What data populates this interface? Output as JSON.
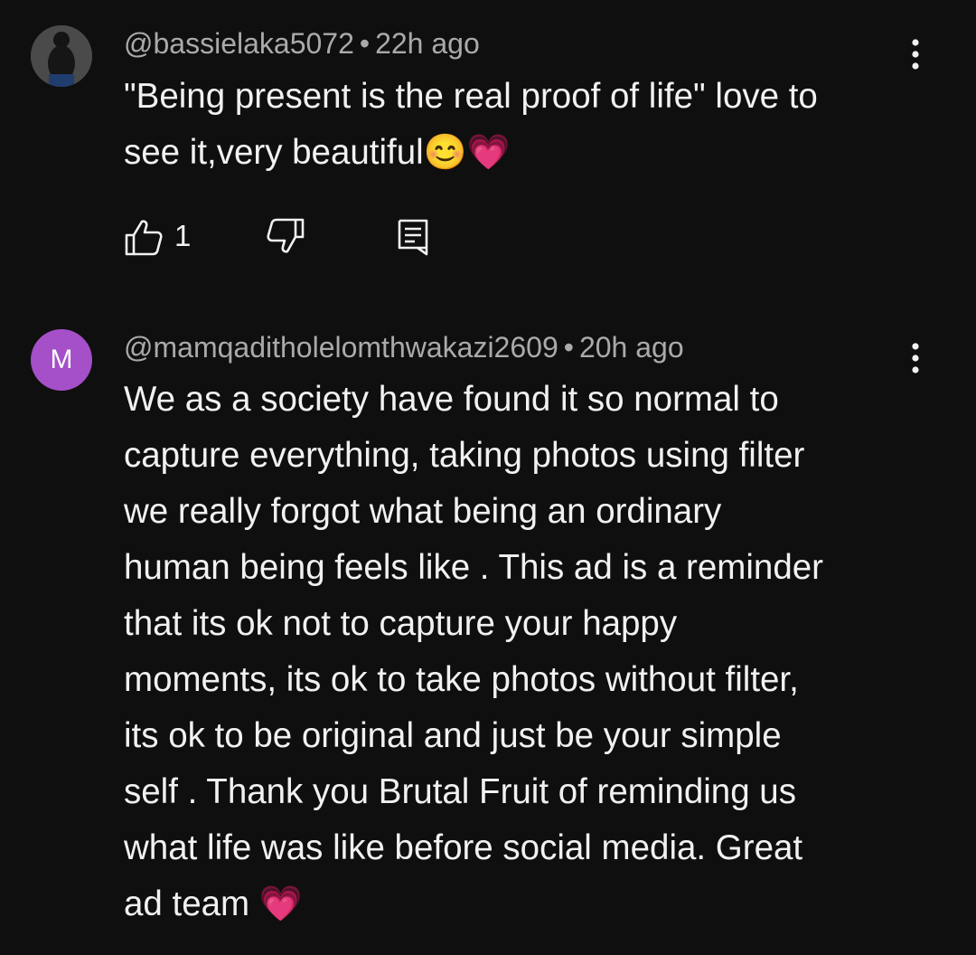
{
  "comments": [
    {
      "author": "@bassielaka5072",
      "separator": "•",
      "time": "22h ago",
      "text": "\"Being present is the real proof of life\" love to\nsee it,very beautiful😊💗",
      "likes": "1",
      "avatar_icon": "user-photo"
    },
    {
      "author": "@mamqaditholelomthwakazi2609",
      "separator": "•",
      "time": "20h ago",
      "avatar_letter": "M",
      "text": "We as a society have found it so normal to\ncapture everything, taking photos using filter\nwe really forgot what being an ordinary\nhuman being feels like . This ad is a reminder\nthat its ok not to capture your happy\nmoments, its ok to take photos without filter,\nits ok to be original and just be your simple\nself . Thank you Brutal Fruit of reminding us\nwhat life was like before social media.  Great\nad team 💗"
    }
  ],
  "colors": {
    "background": "#0f0f0f",
    "meta_text": "#aaaaaa",
    "body_text": "#f1f1f1",
    "avatar_letter_bg": "#a54fc8"
  },
  "icons": [
    "like-icon",
    "dislike-icon",
    "reply-icon",
    "more-options-icon"
  ]
}
